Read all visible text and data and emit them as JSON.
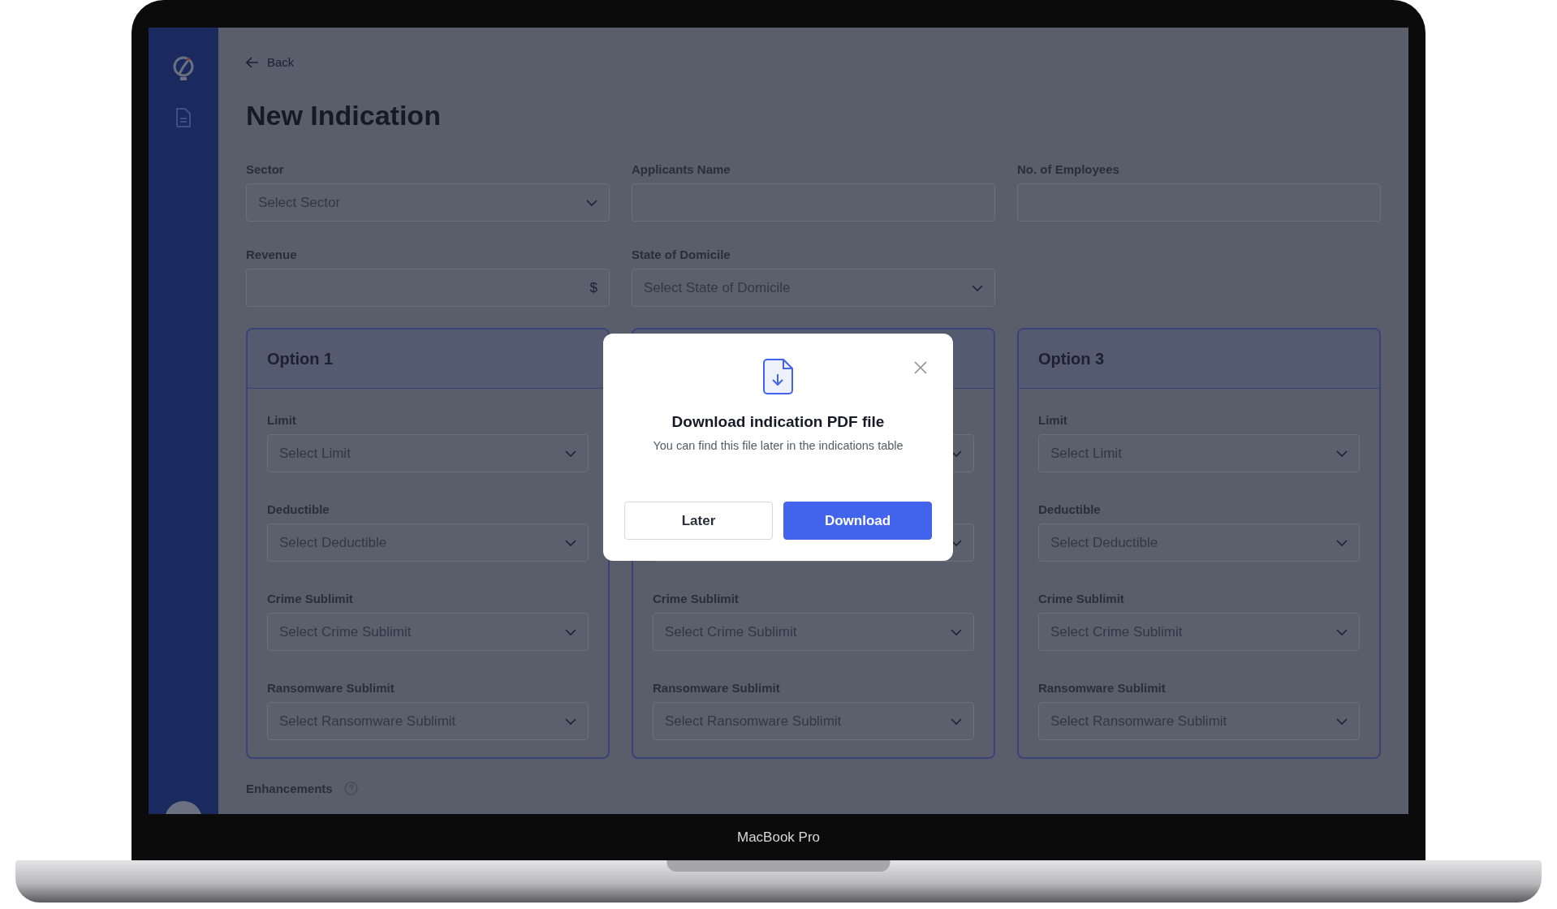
{
  "back": {
    "label": "Back"
  },
  "title": "New Indication",
  "fields": [
    {
      "label": "Sector",
      "kind": "select",
      "placeholder": "Select Sector"
    },
    {
      "label": "Applicants Name",
      "kind": "text"
    },
    {
      "label": "No. of Employees",
      "kind": "text"
    },
    {
      "label": "Revenue",
      "kind": "currency",
      "suffix": "$"
    },
    {
      "label": "State of Domicile",
      "kind": "select",
      "placeholder": "Select State of Domicile"
    }
  ],
  "options": [
    {
      "title": "Option 1",
      "fields": [
        {
          "kind": "select",
          "label": "Limit",
          "placeholder": "Select Limit"
        },
        {
          "kind": "select",
          "label": "Deductible",
          "placeholder": "Select Deductible"
        },
        {
          "kind": "select",
          "label": "Crime Sublimit",
          "placeholder": "Select Crime Sublimit"
        },
        {
          "kind": "select",
          "label": "Ransomware Sublimit",
          "placeholder": "Select Ransomware Sublimit"
        }
      ]
    },
    {
      "fields": [
        {
          "kind": "select"
        },
        {
          "kind": "select"
        },
        {
          "kind": "select",
          "label": "Crime Sublimit",
          "placeholder": "Select Crime Sublimit"
        },
        {
          "kind": "select",
          "label": "Ransomware Sublimit",
          "placeholder": "Select Ransomware Sublimit"
        }
      ]
    },
    {
      "title": "Option 3",
      "fields": [
        {
          "kind": "select",
          "label": "Limit",
          "placeholder": "Select Limit"
        },
        {
          "kind": "select",
          "label": "Deductible",
          "placeholder": "Select Deductible"
        },
        {
          "kind": "select",
          "label": "Crime Sublimit",
          "placeholder": "Select Crime Sublimit"
        },
        {
          "kind": "select",
          "label": "Ransomware Sublimit",
          "placeholder": "Select Ransomware Sublimit"
        }
      ]
    }
  ],
  "enhancements": {
    "label": "Enhancements"
  },
  "dialog": {
    "title": "Download indication PDF file",
    "message": "You can find this file later in the indications table",
    "buttons": [
      {
        "label": "Later",
        "kind": "secondary"
      },
      {
        "label": "Download",
        "kind": "primary"
      }
    ]
  },
  "device": {
    "caption": "MacBook Pro"
  }
}
